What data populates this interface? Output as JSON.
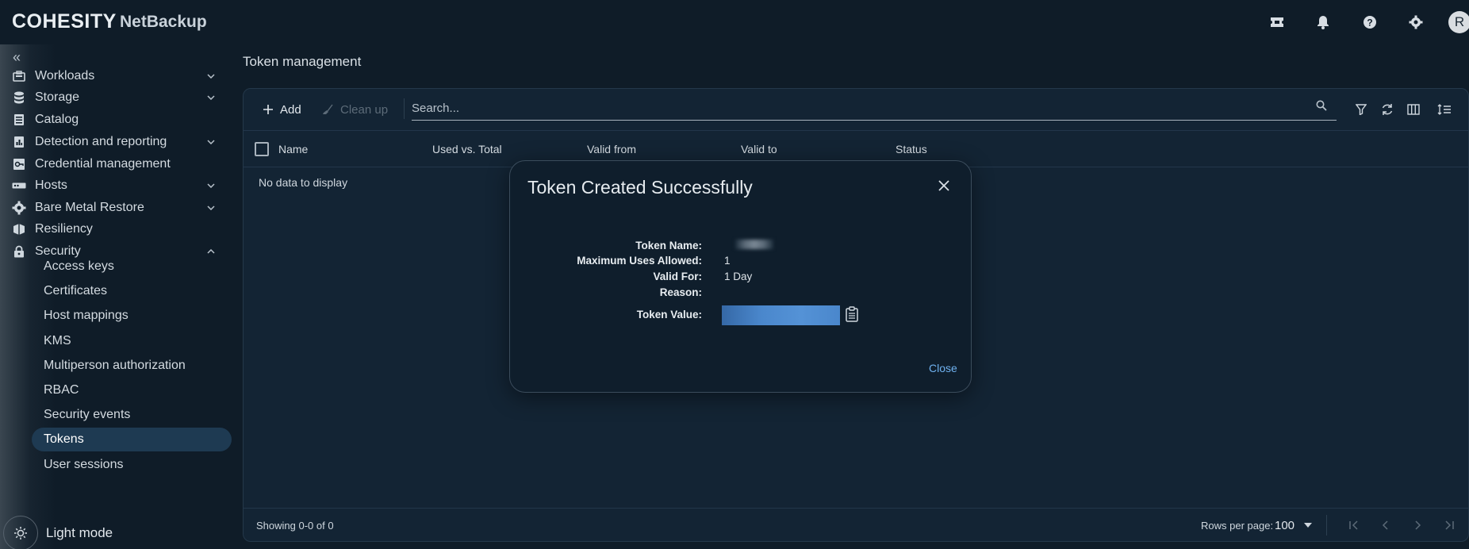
{
  "brand": {
    "logo": "COHESITY",
    "product": "NetBackup"
  },
  "topbar": {
    "icons": [
      "ticket-icon",
      "bell-icon",
      "help-icon",
      "gear-icon"
    ],
    "avatar_letter": "R"
  },
  "sidebar": {
    "collapse_label": "«",
    "items": [
      {
        "label": "Workloads",
        "icon": "briefcase-icon",
        "expandable": true
      },
      {
        "label": "Storage",
        "icon": "database-icon",
        "expandable": true
      },
      {
        "label": "Catalog",
        "icon": "catalog-icon",
        "expandable": false
      },
      {
        "label": "Detection and reporting",
        "icon": "report-icon",
        "expandable": true
      },
      {
        "label": "Credential management",
        "icon": "credential-icon",
        "expandable": false
      },
      {
        "label": "Hosts",
        "icon": "host-icon",
        "expandable": true
      },
      {
        "label": "Bare Metal Restore",
        "icon": "bmr-gear-icon",
        "expandable": true
      },
      {
        "label": "Resiliency",
        "icon": "resiliency-icon",
        "expandable": false
      },
      {
        "label": "Security",
        "icon": "lock-icon",
        "expandable": true,
        "expanded": true
      }
    ],
    "security_sub": [
      "Access keys",
      "Certificates",
      "Host mappings",
      "KMS",
      "Multiperson authorization",
      "RBAC",
      "Security events",
      "Tokens",
      "User sessions"
    ],
    "active_sub": "Tokens",
    "light_mode_label": "Light mode"
  },
  "main": {
    "title": "Token management",
    "toolbar": {
      "add_label": "Add",
      "cleanup_label": "Clean up",
      "search_placeholder": "Search..."
    },
    "columns": [
      "Name",
      "Used vs. Total",
      "Valid from",
      "Valid to",
      "Status"
    ],
    "empty_text": "No data to display",
    "footer": {
      "showing": "Showing 0-0 of 0",
      "rows_per_page_label": "Rows per page:",
      "rows_per_page_value": "100"
    }
  },
  "modal": {
    "title": "Token Created Successfully",
    "fields": {
      "token_name_label": "Token Name:",
      "max_uses_label": "Maximum Uses Allowed:",
      "max_uses_value": "1",
      "valid_for_label": "Valid For:",
      "valid_for_value": "1 Day",
      "reason_label": "Reason:",
      "token_value_label": "Token Value:"
    },
    "close_label": "Close"
  },
  "colors": {
    "background": "#0f1c28",
    "panel": "#132434",
    "active_nav": "#1e3a52",
    "link_blue": "#6fb1ef",
    "token_value_highlight": "#4a87cc"
  }
}
